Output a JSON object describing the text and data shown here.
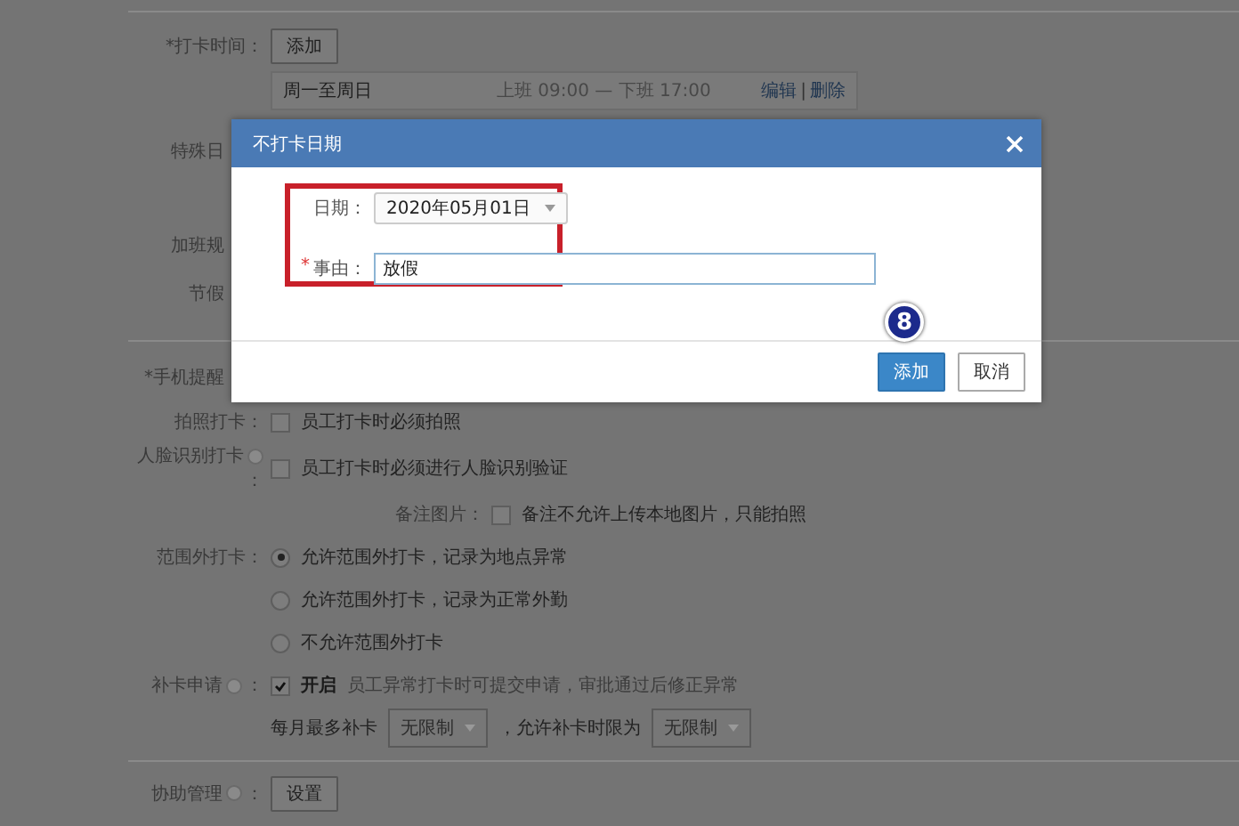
{
  "form": {
    "sections": [
      {
        "rows": [
          {
            "kind": "button",
            "label": "*打卡时间：",
            "button": "添加"
          },
          {
            "kind": "schedule",
            "days": "周一至周日",
            "hours": "上班 09:00 — 下班 17:00",
            "links": [
              "编辑",
              "删除"
            ],
            "separator": "|"
          },
          {
            "kind": "covered",
            "label": "特殊日"
          },
          {
            "kind": "covered",
            "label": "加班规"
          },
          {
            "kind": "covered",
            "label": "节假"
          }
        ]
      },
      {
        "rows": [
          {
            "kind": "covered",
            "label": "*手机提醒"
          },
          {
            "kind": "checkbox",
            "label": "拍照打卡：",
            "checked": false,
            "text": "员工打卡时必须拍照"
          },
          {
            "kind": "checkbox",
            "label": "人脸识别打卡",
            "info": true,
            "colon": "：",
            "checked": false,
            "text": "员工打卡时必须进行人脸识别验证"
          },
          {
            "kind": "subcheckbox",
            "label": "备注图片：",
            "checked": false,
            "text": "备注不允许上传本地图片，只能拍照"
          },
          {
            "kind": "radio",
            "label": "范围外打卡：",
            "options": [
              {
                "text": "允许范围外打卡，记录为地点异常",
                "selected": true
              },
              {
                "text": "允许范围外打卡，记录为正常外勤",
                "selected": false
              },
              {
                "text": "不允许范围外打卡",
                "selected": false
              }
            ]
          },
          {
            "kind": "checkbox",
            "label": "补卡申请",
            "info": true,
            "colon": "：",
            "checked": true,
            "strong": "开启",
            "text": "员工异常打卡时可提交申请，审批通过后修正异常"
          },
          {
            "kind": "limits",
            "text": "每月最多补卡",
            "select": "无限制",
            "text2": "，允许补卡时限为",
            "select2": "无限制"
          }
        ]
      },
      {
        "rows": [
          {
            "kind": "button",
            "label": "协助管理",
            "info": true,
            "colon": "：",
            "button": "设置"
          }
        ]
      }
    ]
  },
  "dialog": {
    "title": "不打卡日期",
    "fields": [
      {
        "kind": "select",
        "label": "日期：",
        "value": "2020年05月01日"
      },
      {
        "kind": "input",
        "required_mark": "*",
        "label": "事由：",
        "value": "放假"
      }
    ],
    "buttons": [
      {
        "label": "添加",
        "primary": true
      },
      {
        "label": "取消",
        "primary": false
      }
    ],
    "step_badge": "8"
  }
}
